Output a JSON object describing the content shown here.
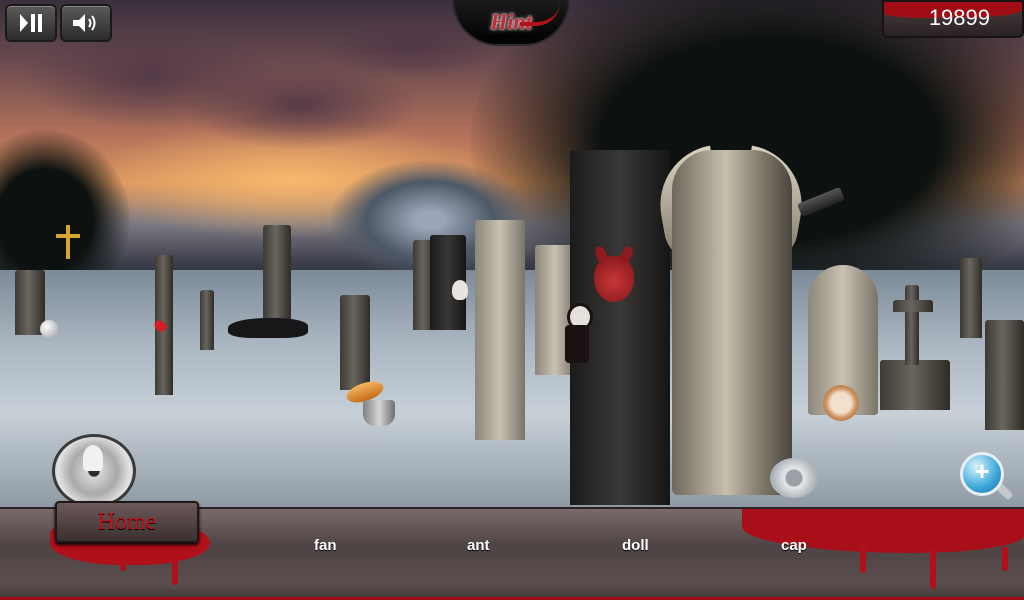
{
  "controls": {
    "pause_icon": "pause-icon",
    "sound_icon": "speaker-icon",
    "hint_label": "Hint",
    "score": "19899",
    "zoom_icon": "zoom-in-icon"
  },
  "bottom_bar": {
    "home_label": "Home",
    "find_words": [
      "fan",
      "ant",
      "doll",
      "cap"
    ]
  },
  "colors": {
    "blood": "#b0101a",
    "hint_text": "#c42a33",
    "bar_bg": "#5b4e4f"
  }
}
